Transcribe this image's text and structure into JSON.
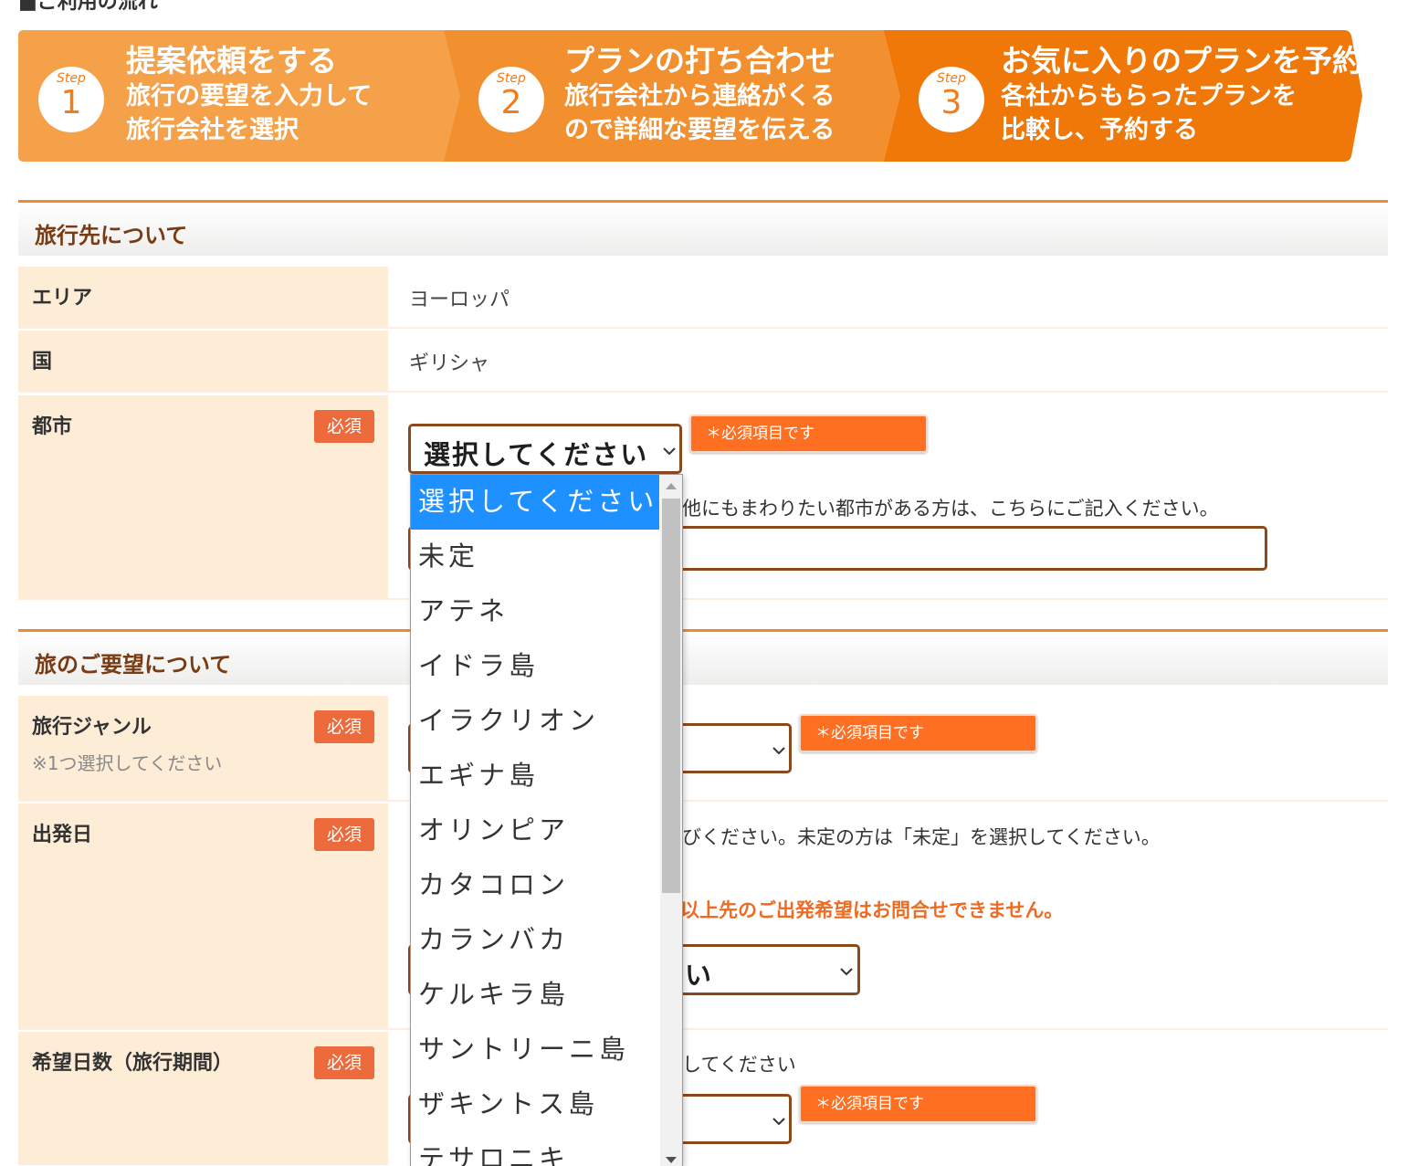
{
  "flow": {
    "title": "■ご利用の流れ",
    "steps": [
      {
        "label": "Step",
        "num": "1",
        "title": "提案依頼をする",
        "line1": "旅行の要望を入力して",
        "line2": "旅行会社を選択"
      },
      {
        "label": "Step",
        "num": "2",
        "title": "プランの打ち合わせ",
        "line1": "旅行会社から連絡がくる",
        "line2": "ので詳細な要望を伝える"
      },
      {
        "label": "Step",
        "num": "3",
        "title": "お気に入りのプランを予約",
        "line1": "各社からもらったプランを",
        "line2": "比較し、予約する"
      }
    ]
  },
  "destination": {
    "heading": "旅行先について",
    "area_label": "エリア",
    "area_value": "ヨーロッパ",
    "country_label": "国",
    "country_value": "ギリシャ",
    "city_label": "都市",
    "required": "必須",
    "city_select": "選択してください",
    "error": "＊必須項目です",
    "other_city_note": "他にもまわりたい都市がある方は、こちらにご記入ください。"
  },
  "request": {
    "heading": "旅のご要望について",
    "genre_label": "旅行ジャンル",
    "genre_note": "※1つ選択してください",
    "required": "必須",
    "genre_error": "＊必須項目です",
    "depart_label": "出発日",
    "depart_note_partial": "びください。未定の方は「未定」を選択してください。",
    "depart_warning_partial": "以上先のご出発希望はお問合せできません。",
    "depart_select_partial": "い",
    "days_label": "希望日数（旅行期間）",
    "days_note_partial": "してください",
    "days_error": "＊必須項目です"
  },
  "city_dropdown": {
    "options": [
      "選択してください",
      "未定",
      "アテネ",
      "イドラ島",
      "イラクリオン",
      "エギナ島",
      "オリンピア",
      "カタコロン",
      "カランバカ",
      "ケルキラ島",
      "サントリーニ島",
      "ザキントス島",
      "テサロニキ"
    ],
    "selected": "選択してください"
  },
  "colors": {
    "accent": "#ef8a31",
    "required_badge": "#ec6a3c",
    "error_badge": "#ff6f22",
    "label_bg": "#fdedd7",
    "selected_option": "#1e90ff"
  }
}
